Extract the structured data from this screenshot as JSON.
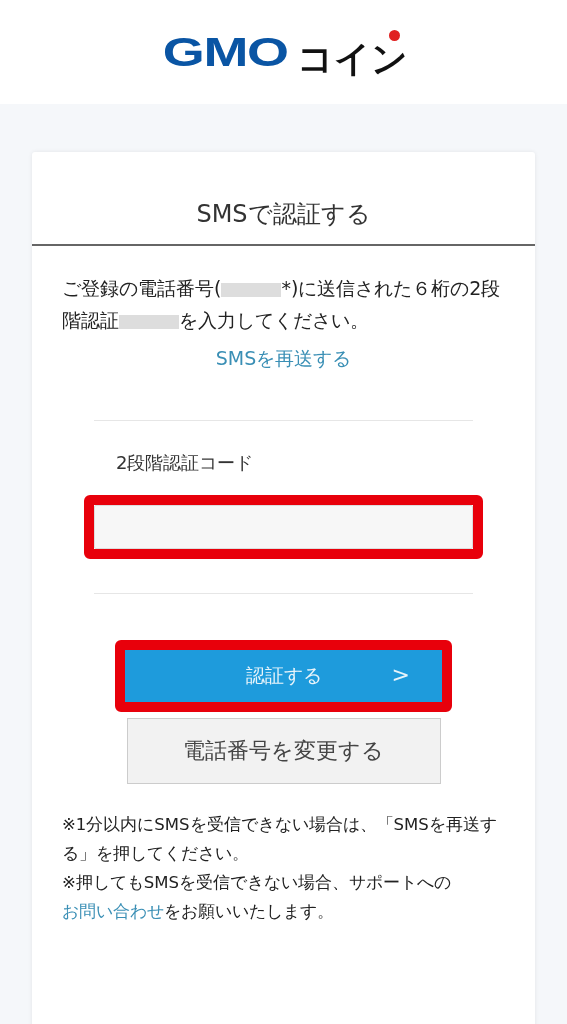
{
  "header": {
    "logo_latin": "GMO",
    "logo_kana": "コイン"
  },
  "card": {
    "title": "SMSで認証する",
    "message_parts": [
      "ご登録の電話番号(",
      "*)に送信された６桁の2段階認証",
      "を入力してください。"
    ],
    "resend_link": "SMSを再送する",
    "code_field": {
      "label": "2段階認証コード",
      "highlighted": true
    },
    "submit_button": {
      "label": "認証する",
      "icon": ">",
      "highlighted": true
    },
    "change_phone_button": {
      "label": "電話番号を変更する"
    },
    "notes": [
      {
        "text": "※1分以内にSMSを受信できない場合は、「SMSを再送する」を押してください。"
      },
      {
        "text": "※押してもSMSを受信できない場合、サポートへの",
        "link": "お問い合わせ",
        "after": "をお願いいたします。"
      }
    ]
  }
}
